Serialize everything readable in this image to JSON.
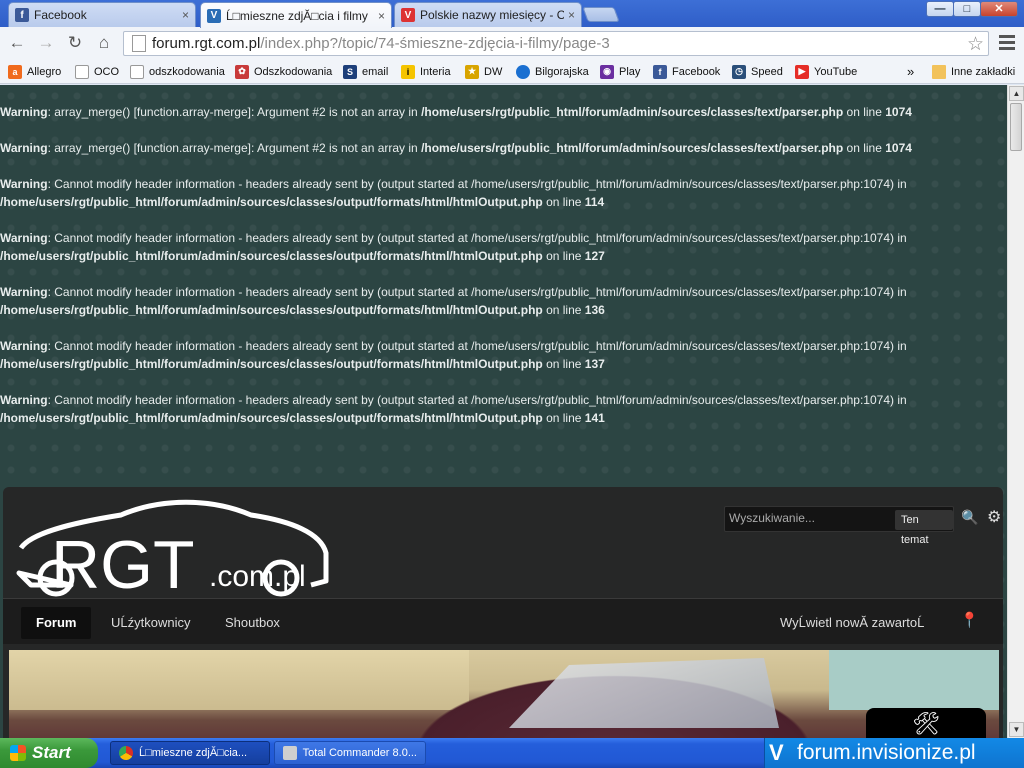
{
  "tabs": [
    {
      "title": "Facebook",
      "icon": "facebook-icon",
      "close": "×"
    },
    {
      "title": "Ĺ□mieszne zdjĂ□cia i filmy",
      "icon": "invision-icon",
      "close": "×"
    },
    {
      "title": "Polskie nazwy miesięcy - Ogó",
      "icon": "opera-icon",
      "close": "×"
    }
  ],
  "window_controls": {
    "minimize": "—",
    "maximize": "□",
    "close": "✕"
  },
  "nav": {
    "back": "←",
    "forward": "→",
    "reload": "↻",
    "home": "⌂"
  },
  "address": {
    "host": "forum.rgt.com.pl",
    "path": "/index.php?/topic/74-śmieszne-zdjęcia-i-filmy/page-3",
    "star": "☆"
  },
  "bookmarks": [
    {
      "label": "Allegro",
      "icon": "allegro-icon",
      "color": "#f06a1d"
    },
    {
      "label": "OCO",
      "icon": "page-icon",
      "color": "#ffffff"
    },
    {
      "label": "odszkodowania",
      "icon": "page-icon",
      "color": "#ffffff"
    },
    {
      "label": "Odszkodowania",
      "icon": "flower-icon",
      "color": "#c83a3a"
    },
    {
      "label": "email",
      "icon": "email-icon",
      "color": "#1d3f7a"
    },
    {
      "label": "Interia",
      "icon": "interia-icon",
      "color": "#f5c400"
    },
    {
      "label": "DW",
      "icon": "dw-icon",
      "color": "#d8a400"
    },
    {
      "label": "Bilgorajska",
      "icon": "globe-icon",
      "color": "#1a6fd1"
    },
    {
      "label": "Play",
      "icon": "play-icon",
      "color": "#6b2fa0"
    },
    {
      "label": "Facebook",
      "icon": "facebook-icon",
      "color": "#3b5998"
    },
    {
      "label": "Speed",
      "icon": "speed-icon",
      "color": "#2a4f7a"
    },
    {
      "label": "YouTube",
      "icon": "youtube-icon",
      "color": "#e52d27"
    }
  ],
  "bookmarks_more": "»",
  "other_bookmarks": "Inne zakładki",
  "warnings": [
    {
      "label": "Warning",
      "msg": ": array_merge() [function.array-merge]: Argument #2 is not an array in ",
      "path": "/home/users/rgt/public_html/forum/admin/sources/classes/text/parser.php",
      "on": " on line ",
      "line": "1074"
    },
    {
      "label": "Warning",
      "msg": ": array_merge() [function.array-merge]: Argument #2 is not an array in ",
      "path": "/home/users/rgt/public_html/forum/admin/sources/classes/text/parser.php",
      "on": " on line ",
      "line": "1074"
    },
    {
      "label": "Warning",
      "msg": ": Cannot modify header information - headers already sent by (output started at /home/users/rgt/public_html/forum/admin/sources/classes/text/parser.php:1074) in ",
      "path": "/home/users/rgt/public_html/forum/admin/sources/classes/output/formats/html/htmlOutput.php",
      "on": " on line ",
      "line": "114"
    },
    {
      "label": "Warning",
      "msg": ": Cannot modify header information - headers already sent by (output started at /home/users/rgt/public_html/forum/admin/sources/classes/text/parser.php:1074) in ",
      "path": "/home/users/rgt/public_html/forum/admin/sources/classes/output/formats/html/htmlOutput.php",
      "on": " on line ",
      "line": "127"
    },
    {
      "label": "Warning",
      "msg": ": Cannot modify header information - headers already sent by (output started at /home/users/rgt/public_html/forum/admin/sources/classes/text/parser.php:1074) in ",
      "path": "/home/users/rgt/public_html/forum/admin/sources/classes/output/formats/html/htmlOutput.php",
      "on": " on line ",
      "line": "136"
    },
    {
      "label": "Warning",
      "msg": ": Cannot modify header information - headers already sent by (output started at /home/users/rgt/public_html/forum/admin/sources/classes/text/parser.php:1074) in ",
      "path": "/home/users/rgt/public_html/forum/admin/sources/classes/output/formats/html/htmlOutput.php",
      "on": " on line ",
      "line": "137"
    },
    {
      "label": "Warning",
      "msg": ": Cannot modify header information - headers already sent by (output started at /home/users/rgt/public_html/forum/admin/sources/classes/text/parser.php:1074) in ",
      "path": "/home/users/rgt/public_html/forum/admin/sources/classes/output/formats/html/htmlOutput.php",
      "on": " on line ",
      "line": "141"
    }
  ],
  "forum": {
    "logo_text": "RGT",
    "logo_suffix": ".com.pl",
    "search_placeholder": "Wyszukiwanie...",
    "search_scope": "Ten temat",
    "search_icon": "🔍",
    "settings_icon": "⚙",
    "nav": [
      "Forum",
      "UĹźytkownicy",
      "Shoutbox"
    ],
    "new_content": "WyĹwietl nowĂ zawartoĹ",
    "pin_icon": "📍",
    "tool_icon": "🛠"
  },
  "taskbar": {
    "start": "Start",
    "tasks": [
      {
        "label": "Ĺ□mieszne zdjĂ□cia...",
        "icon": "chrome-icon",
        "color": "#d93025"
      },
      {
        "label": "Total Commander 8.0...",
        "icon": "total-commander-icon",
        "color": "#cfcfcf"
      }
    ],
    "tray_text": "forum.invisionize.pl"
  },
  "colors": {
    "page_bg": "#2c4543",
    "forum_bg": "#262727",
    "taskbar": "#245edb"
  }
}
